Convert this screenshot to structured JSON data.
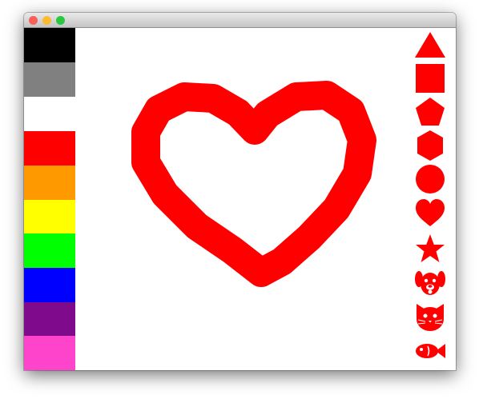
{
  "window": {
    "controls": {
      "close_color": "#fc5f57",
      "minimize_color": "#fdbb2f",
      "zoom_color": "#28c840"
    }
  },
  "palette": {
    "colors": [
      {
        "name": "black",
        "hex": "#000000"
      },
      {
        "name": "gray",
        "hex": "#808080"
      },
      {
        "name": "white",
        "hex": "#ffffff"
      },
      {
        "name": "red",
        "hex": "#ff0000"
      },
      {
        "name": "orange",
        "hex": "#ff9900"
      },
      {
        "name": "yellow",
        "hex": "#ffff00"
      },
      {
        "name": "green",
        "hex": "#00ff00"
      },
      {
        "name": "blue",
        "hex": "#0000ff"
      },
      {
        "name": "purple",
        "hex": "#7f0a8c"
      },
      {
        "name": "pink",
        "hex": "#ff44cc"
      }
    ]
  },
  "canvas": {
    "drawing": "heart-outline",
    "stroke_color": "#ff0000"
  },
  "stamps": {
    "color": "#ff0000",
    "items": [
      {
        "icon": "triangle-icon"
      },
      {
        "icon": "square-icon"
      },
      {
        "icon": "pentagon-icon"
      },
      {
        "icon": "hexagon-icon"
      },
      {
        "icon": "circle-icon"
      },
      {
        "icon": "heart-icon"
      },
      {
        "icon": "star-icon"
      },
      {
        "icon": "dog-icon"
      },
      {
        "icon": "cat-icon"
      },
      {
        "icon": "fish-icon"
      }
    ]
  }
}
